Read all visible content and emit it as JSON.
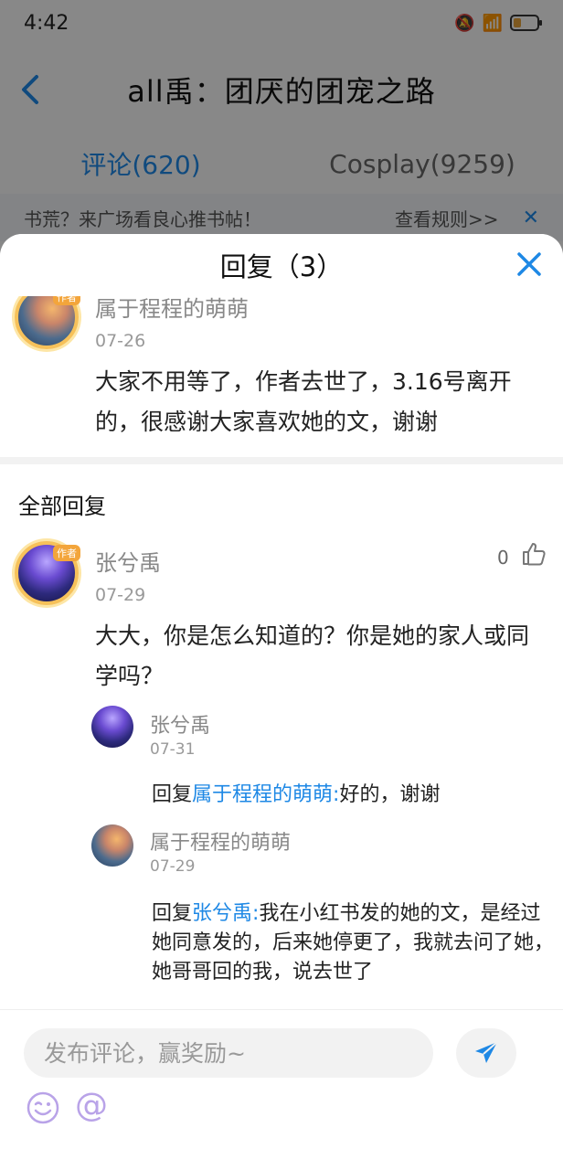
{
  "status_bar": {
    "time": "4:42"
  },
  "header": {
    "title": "all禹：团厌的团宠之路"
  },
  "tabs": [
    {
      "label": "评论(620)",
      "active": true
    },
    {
      "label": "Cosplay(9259)",
      "active": false
    }
  ],
  "notice": {
    "text": "书荒？来广场看良心推书帖！",
    "rules_link": "查看规则>>"
  },
  "sheet": {
    "title": "回复（3）",
    "original_comment": {
      "user": "属于程程的萌萌",
      "badge": "作者",
      "date": "07-26",
      "text": "大家不用等了，作者去世了，3.16号离开的，很感谢大家喜欢她的文，谢谢"
    },
    "section_title": "全部回复",
    "replies": [
      {
        "user": "张兮禹",
        "badge": "作者",
        "date": "07-29",
        "likes": "0",
        "text": "大大，你是怎么知道的？你是她的家人或同学吗？",
        "sub_replies": [
          {
            "user": "张兮禹",
            "date": "07-31",
            "reply_prefix": "回复",
            "reply_to": "属于程程的萌萌:",
            "text": "好的，谢谢"
          },
          {
            "user": "属于程程的萌萌",
            "date": "07-29",
            "reply_prefix": "回复",
            "reply_to": "张兮禹:",
            "text": "我在小红书发的她的文，是经过她同意发的，后来她停更了，我就去问了她，她哥哥回的我，说去世了"
          }
        ]
      }
    ]
  },
  "input": {
    "placeholder": "发布评论，赢奖励~"
  },
  "colors": {
    "accent": "#1e88e5",
    "send_icon": "#1e88e5"
  }
}
